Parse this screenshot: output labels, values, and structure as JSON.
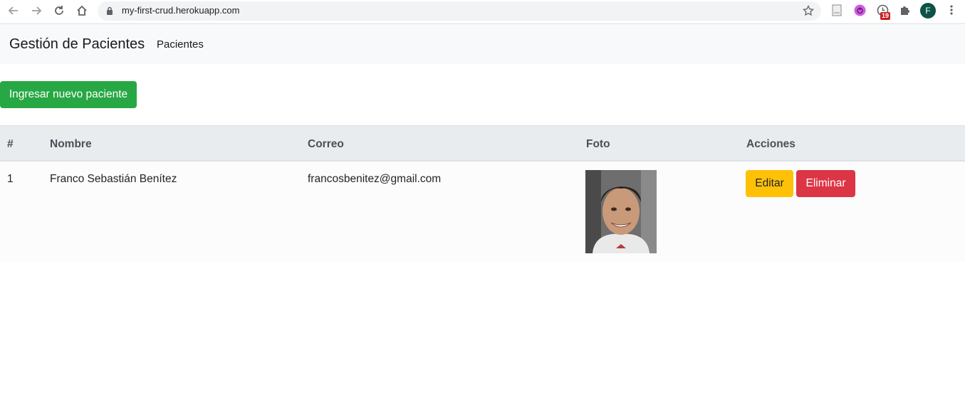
{
  "browser": {
    "url": "my-first-crud.herokuapp.com",
    "extension_badge": "19",
    "profile_initial": "F"
  },
  "navbar": {
    "brand": "Gestión de Pacientes",
    "links": [
      "Pacientes"
    ]
  },
  "actions": {
    "new_patient_label": "Ingresar nuevo paciente"
  },
  "table": {
    "columns": [
      "#",
      "Nombre",
      "Correo",
      "Foto",
      "Acciones"
    ],
    "rows": [
      {
        "id": "1",
        "nombre": "Franco Sebastián Benítez",
        "correo": "francosbenitez@gmail.com",
        "edit_label": "Editar",
        "delete_label": "Eliminar"
      }
    ]
  },
  "colors": {
    "success": "#28a745",
    "warning": "#ffc107",
    "danger": "#dc3545",
    "navbar_bg": "#f8f9fa",
    "thead_bg": "#e9ecef"
  }
}
